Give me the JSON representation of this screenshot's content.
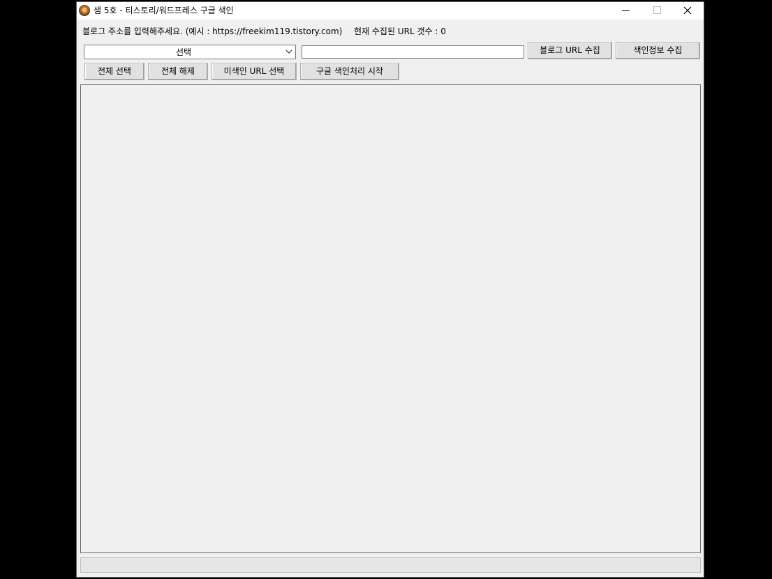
{
  "window": {
    "title": "샘 5호 - 티스토리/워드프레스 구글 색인"
  },
  "header": {
    "instruction": "블로그 주소를 입력해주세요. (예시 : https://freekim119.tistory.com)",
    "url_count": "현재 수집된 URL 갯수 : 0"
  },
  "controls": {
    "select_value": "선택",
    "url_input_value": "",
    "collect_url_button": "블로그 URL 수집",
    "collect_index_button": "색인정보 수집"
  },
  "actions": {
    "select_all": "전체 선택",
    "deselect_all": "전체 해제",
    "select_unindexed": "미색인 URL 선택",
    "start_indexing": "구글 색인처리 시작"
  },
  "list": {
    "items": []
  },
  "status": {
    "text": ""
  }
}
